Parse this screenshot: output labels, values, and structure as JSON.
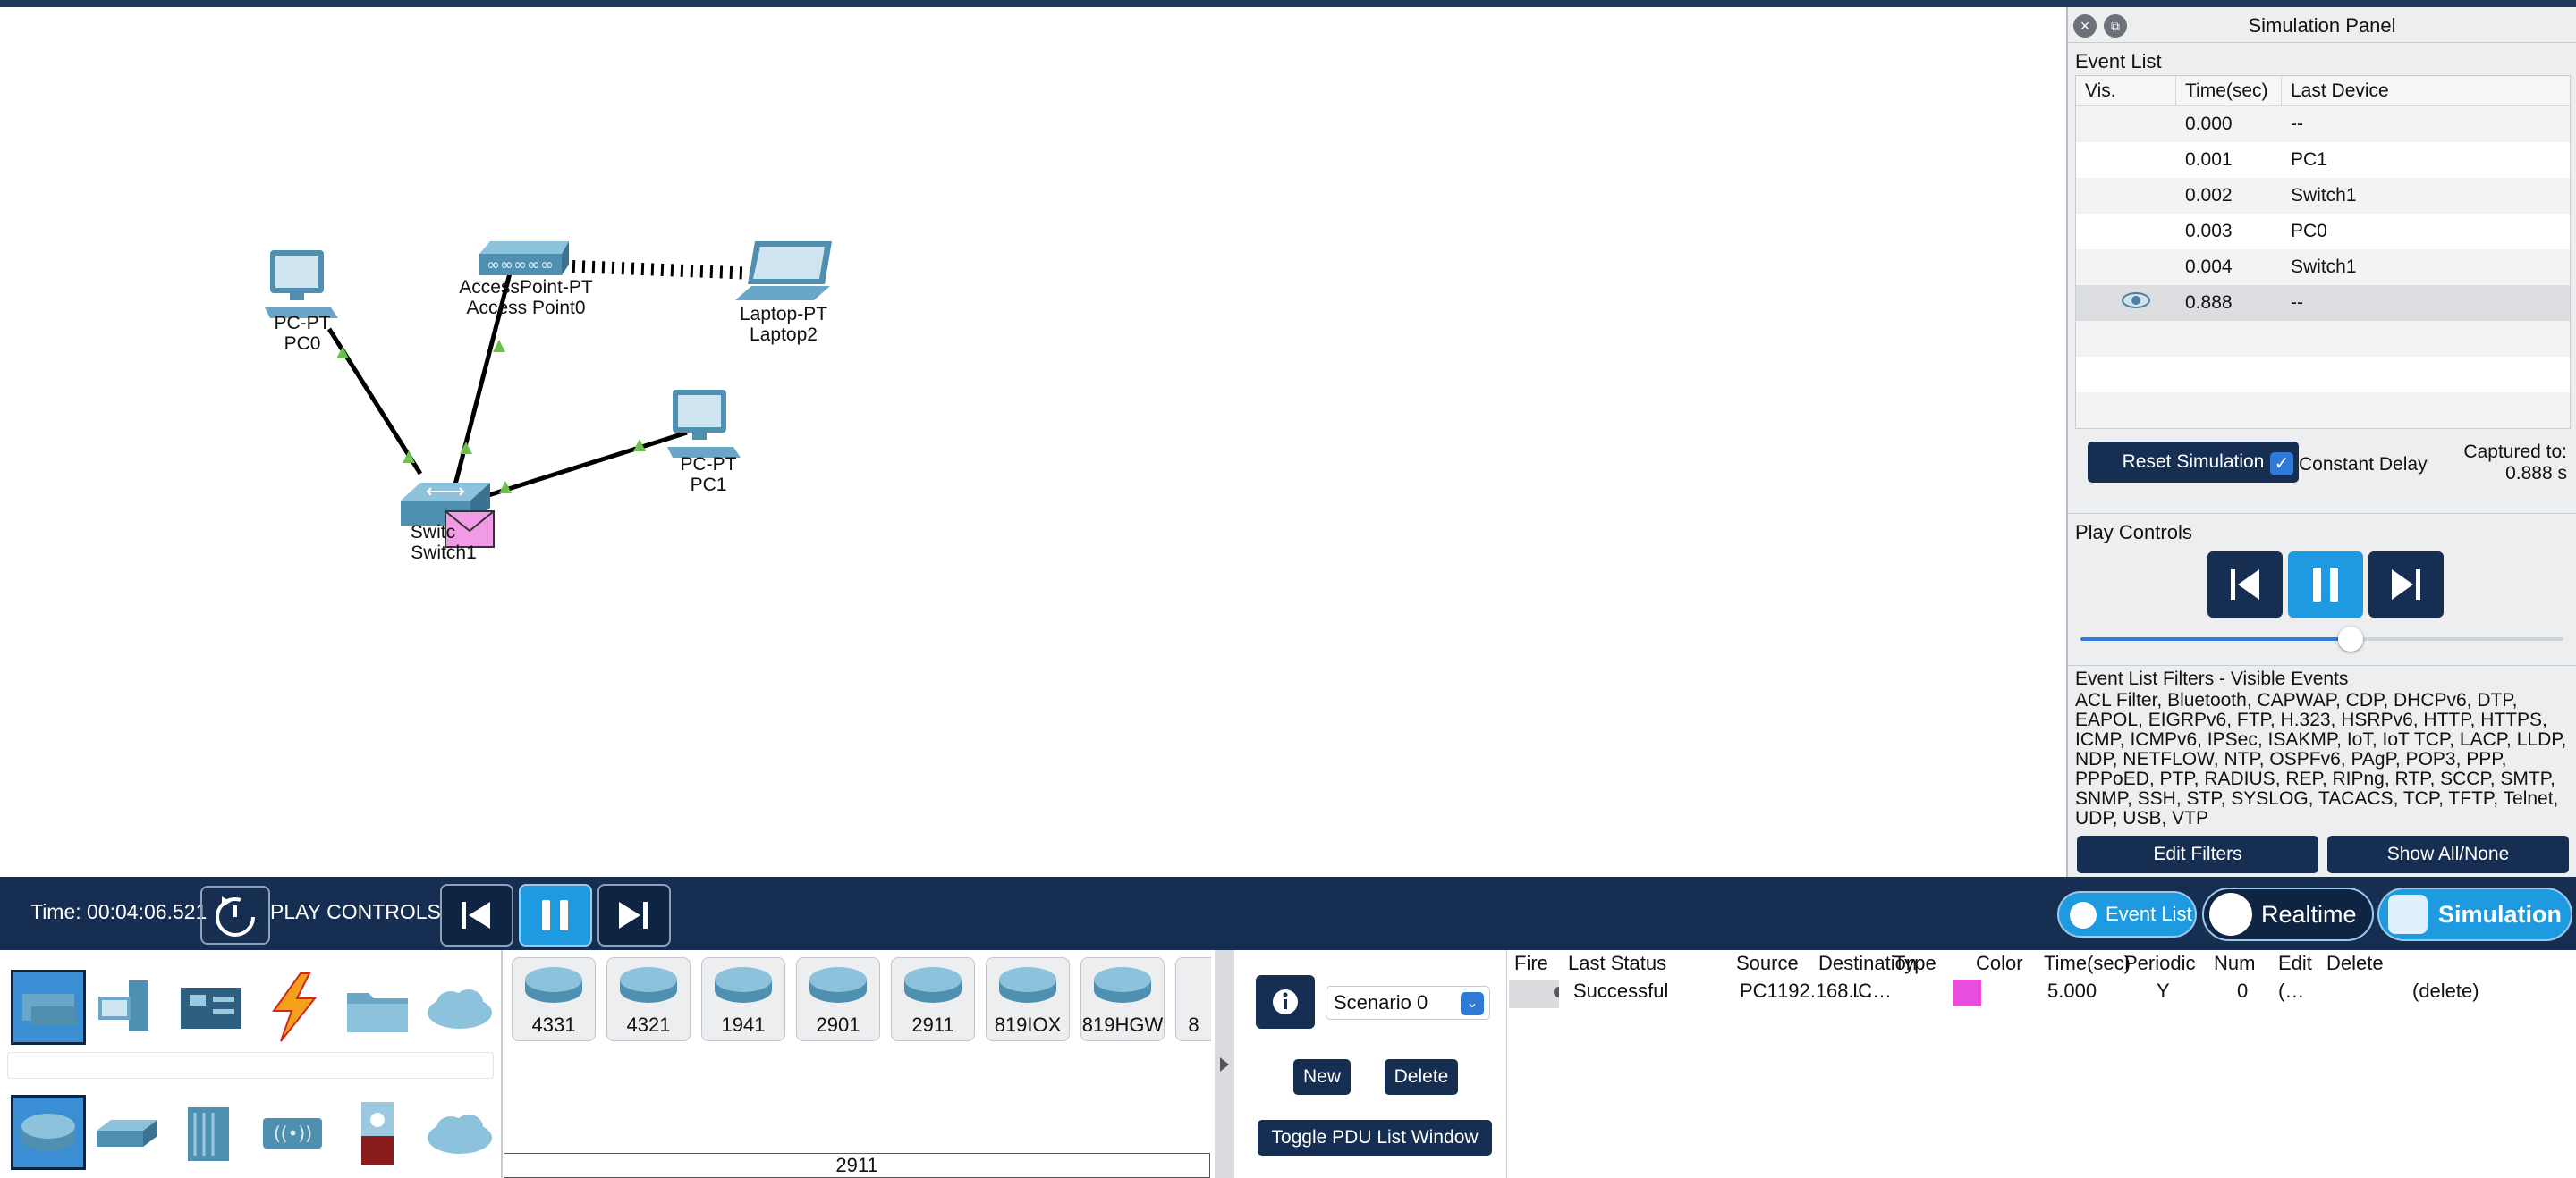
{
  "workspace": {
    "devices": [
      {
        "id": "pc0",
        "model": "PC-PT",
        "name": "PC0"
      },
      {
        "id": "ap0",
        "model": "AccessPoint-PT",
        "name": "Access Point0"
      },
      {
        "id": "laptop2",
        "model": "Laptop-PT",
        "name": "Laptop2"
      },
      {
        "id": "pc1",
        "model": "PC-PT",
        "name": "PC1"
      },
      {
        "id": "switch1",
        "model": "Switc",
        "name": "Switch1"
      }
    ]
  },
  "simulation_panel": {
    "title": "Simulation Panel",
    "event_list_title": "Event List",
    "columns": {
      "vis": "Vis.",
      "time": "Time(sec)",
      "last_device": "Last Device"
    },
    "events": [
      {
        "time": "0.000",
        "device": "--"
      },
      {
        "time": "0.001",
        "device": "PC1"
      },
      {
        "time": "0.002",
        "device": "Switch1"
      },
      {
        "time": "0.003",
        "device": "PC0"
      },
      {
        "time": "0.004",
        "device": "Switch1"
      },
      {
        "time": "0.888",
        "device": "--"
      }
    ],
    "reset_label": "Reset Simulation",
    "constant_delay_label": "Constant Delay",
    "constant_delay_checked": true,
    "captured_label": "Captured to:",
    "captured_value": "0.888 s",
    "play_controls_title": "Play Controls",
    "speed_fraction": 0.56,
    "filters_title": "Event List Filters - Visible Events",
    "filters_text": "ACL Filter, Bluetooth, CAPWAP, CDP, DHCPv6, DTP, EAPOL, EIGRPv6, FTP, H.323, HSRPv6, HTTP, HTTPS, ICMP, ICMPv6, IPSec, ISAKMP, IoT, IoT TCP, LACP, LLDP, NDP, NETFLOW, NTP, OSPFv6, PAgP, POP3, PPP, PPPoED, PTP, RADIUS, REP, RIPng, RTP, SCCP, SMTP, SNMP, SSH, STP, SYSLOG, TACACS, TCP, TFTP, Telnet, UDP, USB, VTP",
    "edit_filters_label": "Edit Filters",
    "show_all_label": "Show All/None"
  },
  "bottom_bar": {
    "time_text": "Time: 00:04:06.521",
    "play_controls_label": "PLAY CONTROLS:",
    "event_list_label": "Event List",
    "realtime_label": "Realtime",
    "simulation_label": "Simulation"
  },
  "device_models": [
    "4331",
    "4321",
    "1941",
    "2901",
    "2911",
    "819IOX",
    "819HGW",
    "8"
  ],
  "selected_model": "2911",
  "scenario": {
    "selected": "Scenario 0",
    "new_label": "New",
    "delete_label": "Delete",
    "toggle_label": "Toggle PDU List Window"
  },
  "pdu_list": {
    "columns": [
      "Fire",
      "Last Status",
      "Source",
      "Destination",
      "Type",
      "Color",
      "Time(sec)",
      "Periodic",
      "Num",
      "Edit",
      "Delete"
    ],
    "rows": [
      {
        "last_status": "Successful",
        "source": "PC1",
        "destination": "192.168.…",
        "type": "IC…",
        "color": "#e94de0",
        "time": "5.000",
        "periodic": "Y",
        "num": "0",
        "edit": "(…",
        "delete": "(delete)"
      }
    ]
  },
  "colors": {
    "navy": "#162e51",
    "accent": "#1e9ae0",
    "link_ok": "#6cc04a"
  }
}
